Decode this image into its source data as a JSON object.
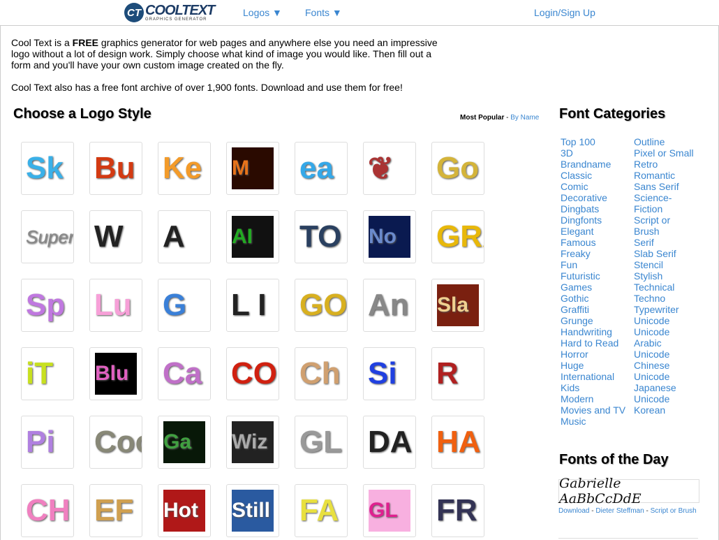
{
  "header": {
    "logo_main": "COOLTEXT",
    "logo_sub": "GRAPHICS GENERATOR",
    "logos": "Logos ▼",
    "fonts": "Fonts ▼",
    "login": "Login/Sign Up"
  },
  "intro": {
    "p1_a": "Cool Text is a ",
    "p1_bold": "FREE",
    "p1_b": " graphics generator for web pages and anywhere else you need an impressive logo without a lot of design work.  Simply choose what kind of image you would like. Then fill out a form and you'll have your own custom image created on the fly.",
    "p2": "Cool Text also has a free font archive of over 1,900 fonts. Download and use them for free!"
  },
  "logo_section": {
    "title": "Choose a Logo Style",
    "sort_active": "Most Popular",
    "sort_sep": " - ",
    "sort_link": "By Name"
  },
  "tiles": [
    [
      {
        "t": "Sk",
        "c": "#3ab0e8",
        "bg": "#fff"
      },
      {
        "t": "Bu",
        "c": "#d33a12",
        "bg": "#fff"
      },
      {
        "t": "Ke",
        "c": "#f39b2a",
        "bg": "#fff"
      },
      {
        "t": "M",
        "c": "#e8731a",
        "bg": "#2a0a00"
      },
      {
        "t": "ea",
        "c": "#35a8e8",
        "bg": "#fff"
      },
      {
        "t": "❦",
        "c": "#a33",
        "bg": "#fff"
      },
      {
        "t": "Go",
        "c": "#d4b43a",
        "bg": "#fff"
      }
    ],
    [
      {
        "t": "Super",
        "c": "#888",
        "bg": "#fff"
      },
      {
        "t": "W",
        "c": "#222",
        "bg": "#fff"
      },
      {
        "t": "A",
        "c": "#222",
        "bg": "#fff"
      },
      {
        "t": "AI",
        "c": "#2a2",
        "bg": "#111"
      },
      {
        "t": "TO",
        "c": "#2a4060",
        "bg": "#fff"
      },
      {
        "t": "No",
        "c": "#6a8acc",
        "bg": "#0a1a50"
      },
      {
        "t": "GRA",
        "c": "#e8b80a",
        "bg": "#fff"
      }
    ],
    [
      {
        "t": "Sp",
        "c": "#c078e0",
        "bg": "#fff"
      },
      {
        "t": "Lu",
        "c": "#f7a0d8",
        "bg": "#fff"
      },
      {
        "t": "G",
        "c": "#3a80d8",
        "bg": "#fff"
      },
      {
        "t": "L I",
        "c": "#222",
        "bg": "#fff"
      },
      {
        "t": "GO",
        "c": "#d8b020",
        "bg": "#fff"
      },
      {
        "t": "An",
        "c": "#888",
        "bg": "#fff"
      },
      {
        "t": "Sla",
        "c": "#f0d090",
        "bg": "#7a2010"
      }
    ],
    [
      {
        "t": "iT",
        "c": "#c8e020",
        "bg": "#fff"
      },
      {
        "t": "Blu",
        "c": "#e060c0",
        "bg": "#000"
      },
      {
        "t": "Ca",
        "c": "#c070c8",
        "bg": "#fff"
      },
      {
        "t": "CO",
        "c": "#d02010",
        "bg": "#fff"
      },
      {
        "t": "Ch",
        "c": "#d0a070",
        "bg": "#fff"
      },
      {
        "t": "Si",
        "c": "#2040e0",
        "bg": "#fff"
      },
      {
        "t": "R",
        "c": "#b02020",
        "bg": "#fff"
      }
    ],
    [
      {
        "t": "Pi",
        "c": "#b080e0",
        "bg": "#fff"
      },
      {
        "t": "Coo",
        "c": "#887",
        "bg": "#fff"
      },
      {
        "t": "Ga",
        "c": "#40a040",
        "bg": "#081808"
      },
      {
        "t": "Wiz",
        "c": "#aaa",
        "bg": "#222"
      },
      {
        "t": "GL",
        "c": "#999",
        "bg": "#fff"
      },
      {
        "t": "DA",
        "c": "#222",
        "bg": "#fff"
      },
      {
        "t": "HA",
        "c": "#f06010",
        "bg": "#fff"
      }
    ],
    [
      {
        "t": "CH",
        "c": "#f080c0",
        "bg": "#fff"
      },
      {
        "t": "EF",
        "c": "#d0a050",
        "bg": "#fff"
      },
      {
        "t": "Hot",
        "c": "#fff",
        "bg": "#b01818"
      },
      {
        "t": "Still",
        "c": "#fff",
        "bg": "#2a5aa0"
      },
      {
        "t": "FA",
        "c": "#e8e040",
        "bg": "#fff"
      },
      {
        "t": "GL",
        "c": "#e02090",
        "bg": "#f8b0e0"
      },
      {
        "t": "FR",
        "c": "#335",
        "bg": "#fff"
      }
    ]
  ],
  "categories": {
    "title": "Font Categories",
    "col1": [
      "Top 100",
      "3D",
      "Brandname",
      "Classic",
      "Comic",
      "Decorative",
      "Dingbats",
      "Dingfonts",
      "Elegant",
      "Famous",
      "Freaky",
      "Fun",
      "Futuristic",
      "Games",
      "Gothic",
      "Graffiti",
      "Grunge",
      "Handwriting",
      "Hard to Read",
      "Horror",
      "Huge",
      "International",
      "Kids",
      "Modern",
      "Movies and TV",
      "Music"
    ],
    "col2": [
      "Outline",
      "Pixel or Small",
      "Retro",
      "Romantic",
      "Sans Serif",
      "Science-",
      "Fiction",
      "Script or",
      "Brush",
      "Serif",
      "Slab Serif",
      "Stencil",
      "Stylish",
      "Technical",
      "Techno",
      "Typewriter",
      "Unicode",
      "Unicode",
      "Arabic",
      "Unicode",
      "Chinese",
      "Unicode",
      "Japanese",
      "Unicode",
      "Korean"
    ]
  },
  "fotd": {
    "title": "Fonts of the Day",
    "sample": "Gabrielle AaBbCcDdE",
    "download": "Download",
    "sep": " - ",
    "author": "Dieter Steffman",
    "category": "Script or Brush"
  },
  "colors": {
    "link": "#3a86d0",
    "border": "#dddddd"
  }
}
